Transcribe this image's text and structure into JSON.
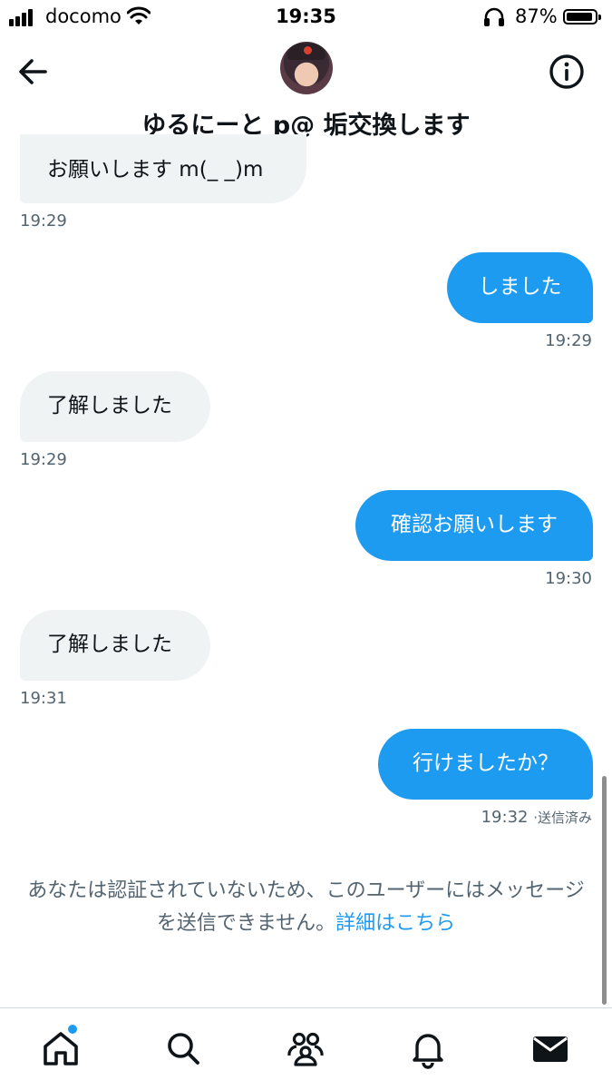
{
  "status_bar": {
    "carrier": "docomo",
    "time": "19:35",
    "battery_percent": "87%",
    "battery_level": 0.87
  },
  "header": {
    "title": "ゆるにーと p@ 垢交換します",
    "back_icon": "arrow-left-icon",
    "info_icon": "info-icon"
  },
  "messages": [
    {
      "direction": "received",
      "text": "お願いします m(_ _)m",
      "time": "19:29"
    },
    {
      "direction": "sent",
      "text": "しました",
      "time": "19:29"
    },
    {
      "direction": "received",
      "text": "了解しました",
      "time": "19:29"
    },
    {
      "direction": "sent",
      "text": "確認お願いします",
      "time": "19:30"
    },
    {
      "direction": "received",
      "text": "了解しました",
      "time": "19:31"
    },
    {
      "direction": "sent",
      "text": "行けましたか？",
      "time": "19:32",
      "status": "送信済み"
    }
  ],
  "notice": {
    "text": "あなたは認証されていないため、このユーザーにはメッセージを送信できません。",
    "link": "詳細はこちら"
  },
  "colors": {
    "accent": "#1d9bf0",
    "received_bubble": "#eff3f4",
    "secondary_text": "#536471"
  },
  "tabbar": {
    "items": [
      "home-icon",
      "search-icon",
      "communities-icon",
      "notifications-icon",
      "messages-icon"
    ],
    "home_has_badge": true
  }
}
